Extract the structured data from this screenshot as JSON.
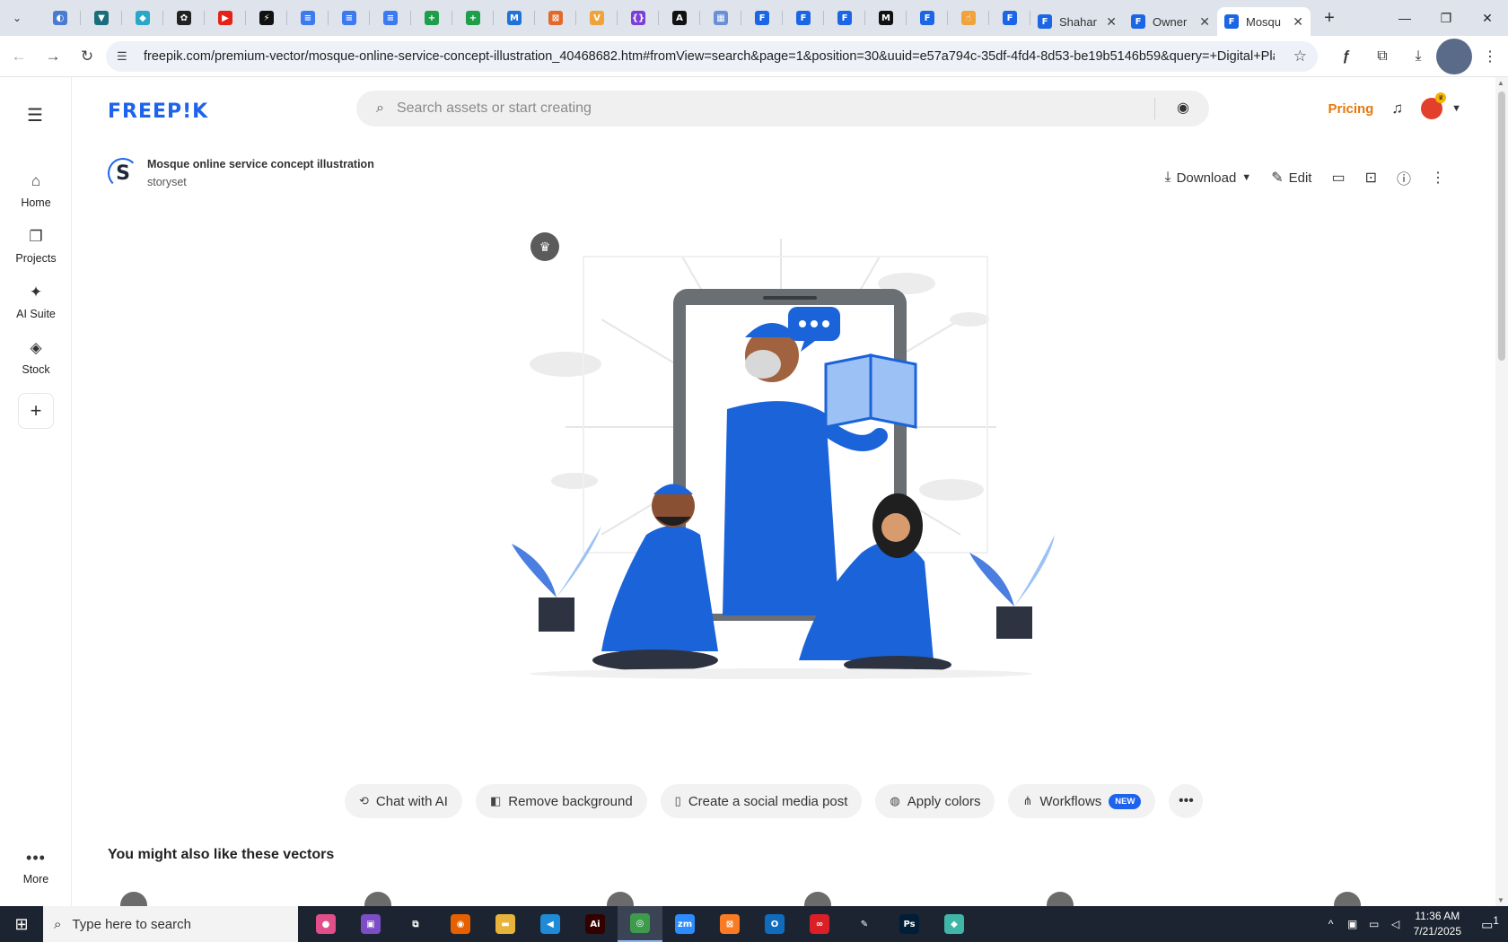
{
  "browser": {
    "pinned_tabs": [
      {
        "icon": "globe-icon",
        "color": "#4a7bd0",
        "glyph": "◐"
      },
      {
        "icon": "vpn-icon",
        "color": "#1a6d7a",
        "glyph": "▼"
      },
      {
        "icon": "hex-icon",
        "color": "#2aa6c7",
        "glyph": "◆"
      },
      {
        "icon": "openai-icon",
        "color": "#222222",
        "glyph": "✿"
      },
      {
        "icon": "youtube-icon",
        "color": "#e62117",
        "glyph": "▶"
      },
      {
        "icon": "bolt-icon",
        "color": "#111111",
        "glyph": "⚡"
      },
      {
        "icon": "docs-icon",
        "color": "#3b7af0",
        "glyph": "≡"
      },
      {
        "icon": "docs-icon",
        "color": "#3b7af0",
        "glyph": "≡"
      },
      {
        "icon": "docs-icon",
        "color": "#3b7af0",
        "glyph": "≡"
      },
      {
        "icon": "sheets-icon",
        "color": "#1e9e4a",
        "glyph": "+"
      },
      {
        "icon": "sheets-icon",
        "color": "#1e9e4a",
        "glyph": "+"
      },
      {
        "icon": "moz-icon",
        "color": "#1f72d6",
        "glyph": "M"
      },
      {
        "icon": "box-icon",
        "color": "#e2692a",
        "glyph": "⊠"
      },
      {
        "icon": "v-icon",
        "color": "#f0a23b",
        "glyph": "V"
      },
      {
        "icon": "code-icon",
        "color": "#7a3fd8",
        "glyph": "{}"
      },
      {
        "icon": "a-icon",
        "color": "#111111",
        "glyph": "A"
      },
      {
        "icon": "seo-icon",
        "color": "#6b8fd6",
        "glyph": "▦"
      },
      {
        "icon": "forms-icon",
        "color": "#1c66e6",
        "glyph": "F"
      },
      {
        "icon": "forms-icon",
        "color": "#1c66e6",
        "glyph": "F"
      },
      {
        "icon": "forms-icon",
        "color": "#1c66e6",
        "glyph": "F"
      },
      {
        "icon": "m-icon",
        "color": "#111111",
        "glyph": "M"
      },
      {
        "icon": "forms-icon",
        "color": "#1c66e6",
        "glyph": "F"
      },
      {
        "icon": "hand-icon",
        "color": "#f0a23b",
        "glyph": "☝"
      },
      {
        "icon": "forms-icon",
        "color": "#1c66e6",
        "glyph": "F"
      }
    ],
    "tabs": [
      {
        "title": "Shahar",
        "favicon_color": "#1c66e6"
      },
      {
        "title": "Owner",
        "favicon_color": "#1c66e6"
      },
      {
        "title": "Mosqu",
        "favicon_color": "#1c66e6"
      }
    ],
    "url": "freepik.com/premium-vector/mosque-online-service-concept-illustration_40468682.htm#fromView=search&page=1&position=30&uuid=e57a794c-35df-4fd4-8d53-be19b5146b59&query=+Digital+Platf..."
  },
  "nav": {
    "items": [
      {
        "label": "Home",
        "icon": "home-icon",
        "glyph": "⌂"
      },
      {
        "label": "Projects",
        "icon": "projects-icon",
        "glyph": "❐"
      },
      {
        "label": "AI Suite",
        "icon": "sparkle-icon",
        "glyph": "✦"
      },
      {
        "label": "Stock",
        "icon": "stock-icon",
        "glyph": "◈"
      }
    ],
    "more_label": "More"
  },
  "header": {
    "logo": "FREEP!K",
    "search_placeholder": "Search assets or start creating",
    "pricing": "Pricing"
  },
  "asset": {
    "title": "Mosque online service concept illustration",
    "author": "storyset",
    "download_label": "Download",
    "edit_label": "Edit"
  },
  "tools": [
    {
      "label": "Chat with AI",
      "icon": "chat-icon",
      "glyph": "⟲"
    },
    {
      "label": "Remove background",
      "icon": "remove-bg-icon",
      "glyph": "◧"
    },
    {
      "label": "Create a social media post",
      "icon": "phone-icon",
      "glyph": "▯"
    },
    {
      "label": "Apply colors",
      "icon": "palette-icon",
      "glyph": "◍"
    },
    {
      "label": "Workflows",
      "icon": "workflow-icon",
      "glyph": "⋔",
      "badge": "NEW"
    }
  ],
  "also_heading": "You might also like these vectors",
  "taskbar": {
    "search_text": "Type here to search",
    "time": "11:36 AM",
    "date": "7/21/2025",
    "notif_count": "1",
    "apps": [
      {
        "icon": "balloons-icon",
        "color": "#e04f8a",
        "glyph": "●"
      },
      {
        "icon": "camera-app-icon",
        "color": "#7c4dc4",
        "glyph": "▣"
      },
      {
        "icon": "task-view-icon",
        "color": "#1c2431",
        "glyph": "⧉"
      },
      {
        "icon": "firefox-icon",
        "color": "#e66000",
        "glyph": "◉"
      },
      {
        "icon": "folder-icon",
        "color": "#e8b33a",
        "glyph": "▬"
      },
      {
        "icon": "vscode-icon",
        "color": "#1f8ad6",
        "glyph": "◀"
      },
      {
        "icon": "illustrator-icon",
        "color": "#330000",
        "glyph": "Ai"
      },
      {
        "icon": "chrome-icon",
        "color": "#3c9c4c",
        "glyph": "◎"
      },
      {
        "icon": "zoom-icon",
        "color": "#2d8cff",
        "glyph": "zm"
      },
      {
        "icon": "xampp-icon",
        "color": "#fb7a24",
        "glyph": "⊠"
      },
      {
        "icon": "outlook-icon",
        "color": "#0f6cbd",
        "glyph": "O"
      },
      {
        "icon": "creative-cloud-icon",
        "color": "#da1f26",
        "glyph": "∞"
      },
      {
        "icon": "pen-icon",
        "color": "#1c2431",
        "glyph": "✎"
      },
      {
        "icon": "photoshop-icon",
        "color": "#001e36",
        "glyph": "Ps"
      },
      {
        "icon": "app-icon",
        "color": "#3fb6a8",
        "glyph": "◆"
      }
    ]
  }
}
